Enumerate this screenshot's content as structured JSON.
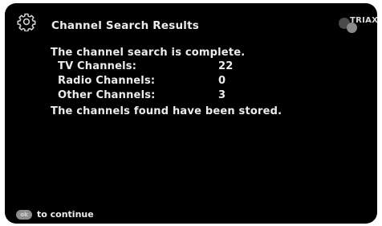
{
  "header": {
    "title": "Channel Search Results",
    "settings_icon": "gear-icon",
    "brand": "TRIAX"
  },
  "results": {
    "status": "The channel search is complete.",
    "rows": [
      {
        "label": "TV Channels:",
        "value": "22"
      },
      {
        "label": "Radio Channels:",
        "value": "0"
      },
      {
        "label": "Other Channels:",
        "value": "3"
      }
    ],
    "stored_message": "The channels found have been stored."
  },
  "footer": {
    "ok_label": "ok",
    "hint": "to continue"
  },
  "colors": {
    "background": "#000000",
    "text": "#ececec",
    "button": "#8e8e8e"
  }
}
